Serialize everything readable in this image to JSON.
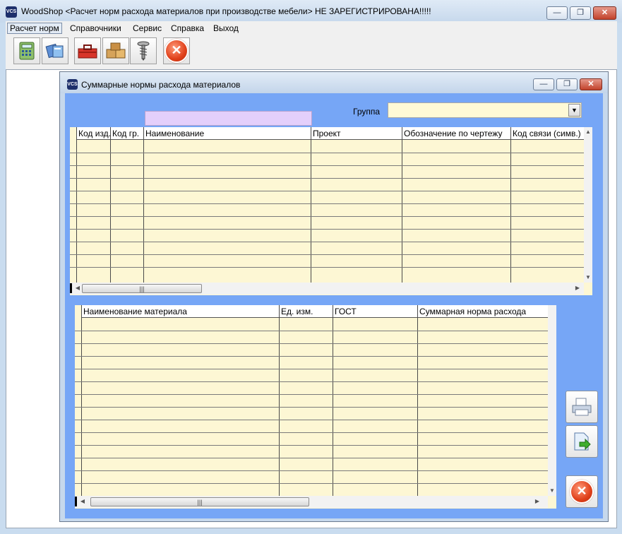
{
  "window": {
    "icon_label": "VCS",
    "title": "WoodShop <Расчет норм расхода материалов при производстве мебели> НЕ ЗАРЕГИСТРИРОВАНА!!!!!"
  },
  "menu": [
    {
      "label": "Расчет норм"
    },
    {
      "label": "Справочники"
    },
    {
      "label": "Сервис"
    },
    {
      "label": "Справка"
    },
    {
      "label": "Выход"
    }
  ],
  "toolbar": {
    "buttons": [
      {
        "name": "calculator-icon"
      },
      {
        "name": "books-icon"
      },
      {
        "name": "toolbox-icon"
      },
      {
        "name": "boxes-icon"
      },
      {
        "name": "screw-icon"
      },
      {
        "name": "close-icon"
      }
    ]
  },
  "child": {
    "icon_label": "VCS",
    "title": "Суммарные нормы расхода материалов"
  },
  "filter": {
    "search_value": "",
    "group_label": "Группа",
    "group_value": ""
  },
  "products_table": {
    "columns": [
      "Код изд.",
      "Код гр.",
      "Наименование",
      "Проект",
      "Обозначение по чертежу",
      "Код связи (симв.)"
    ],
    "rows": []
  },
  "materials_table": {
    "columns": [
      "Наименование материала",
      "Ед. изм.",
      "ГОСТ",
      "Суммарная норма расхода"
    ],
    "rows": []
  },
  "side_buttons": [
    {
      "name": "print-icon"
    },
    {
      "name": "export-icon"
    },
    {
      "name": "close-icon"
    }
  ],
  "colors": {
    "panel_background": "#76a6f6",
    "grid_background": "#fdf7d4",
    "search_background": "#e4cffb",
    "combo_background": "#fffad6"
  }
}
